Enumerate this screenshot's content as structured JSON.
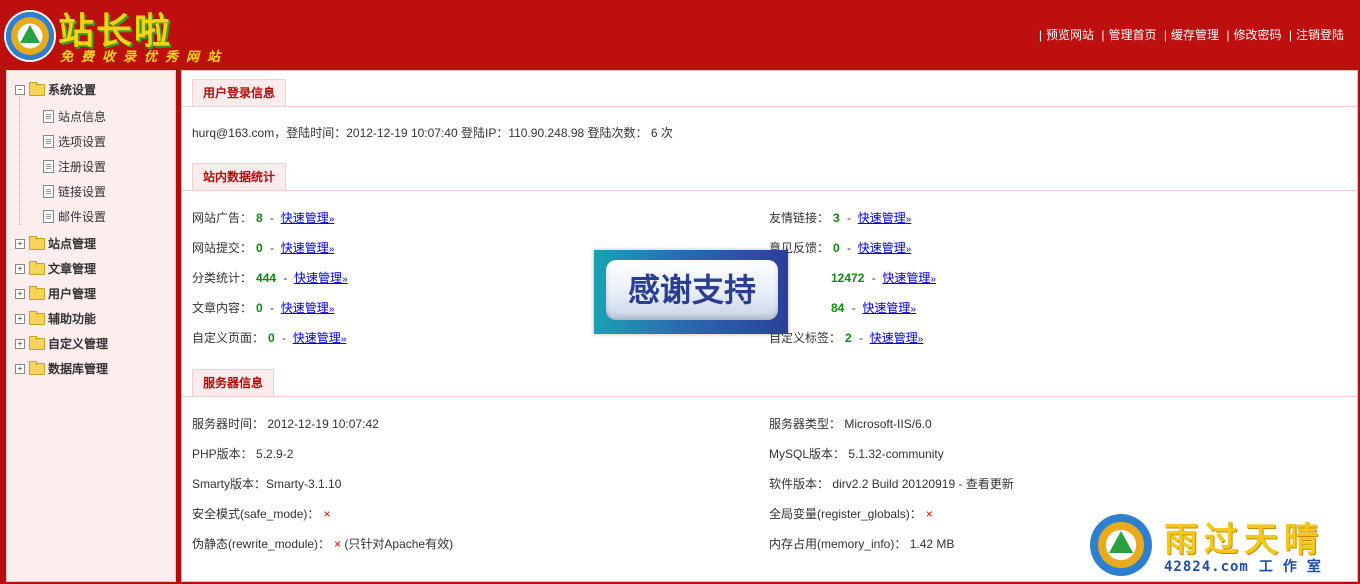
{
  "header": {
    "logo_title": "站长啦",
    "logo_subtitle": "免费收录优秀网站",
    "nav": [
      "预览网站",
      "管理首页",
      "缓存管理",
      "修改密码",
      "注销登陆"
    ]
  },
  "sidebar": {
    "groups": [
      {
        "label": "系统设置",
        "expanded": true,
        "children": [
          "站点信息",
          "选项设置",
          "注册设置",
          "链接设置",
          "邮件设置"
        ]
      },
      {
        "label": "站点管理",
        "expanded": false
      },
      {
        "label": "文章管理",
        "expanded": false
      },
      {
        "label": "用户管理",
        "expanded": false
      },
      {
        "label": "辅助功能",
        "expanded": false
      },
      {
        "label": "自定义管理",
        "expanded": false
      },
      {
        "label": "数据库管理",
        "expanded": false
      }
    ]
  },
  "login_info": {
    "title": "用户登录信息",
    "line": "hurq@163.com，登陆时间：2012-12-19 10:07:40    登陆IP：110.90.248.98    登陆次数： 6 次"
  },
  "stats": {
    "title": "站内数据统计",
    "quick_manage": "快速管理",
    "left": [
      {
        "label": "网站广告：",
        "value": "8"
      },
      {
        "label": "网站提交：",
        "value": "0"
      },
      {
        "label": "分类统计：",
        "value": "444"
      },
      {
        "label": "文章内容：",
        "value": "0"
      },
      {
        "label": "自定义页面：",
        "value": "0"
      }
    ],
    "right": [
      {
        "label": "友情链接：",
        "value": "3"
      },
      {
        "label": "意见反馈：",
        "value": "0"
      },
      {
        "label": "",
        "value": "12472"
      },
      {
        "label": "",
        "value": "84"
      },
      {
        "label": "自定义标签：",
        "value": "2"
      }
    ]
  },
  "server": {
    "title": "服务器信息",
    "left": [
      {
        "label": "服务器时间：",
        "value": "2012-12-19   10:07:42"
      },
      {
        "label": "PHP版本：",
        "value": "5.2.9-2"
      },
      {
        "label": "Smarty版本：",
        "value": "Smarty-3.1.10"
      },
      {
        "label": "安全模式(safe_mode)：",
        "value": "×"
      },
      {
        "label": "伪静态(rewrite_module)：",
        "value": "×",
        "note": "(只针对Apache有效)"
      }
    ],
    "right": [
      {
        "label": "服务器类型：",
        "value": "Microsoft-IIS/6.0"
      },
      {
        "label": "MySQL版本：",
        "value": "5.1.32-community"
      },
      {
        "label": "软件版本：",
        "value": "dirv2.2 Build 20120919 - 查看更新"
      },
      {
        "label": "全局变量(register_globals)：",
        "value": "×"
      },
      {
        "label": "内存占用(memory_info)：",
        "value": "1.42 MB"
      }
    ]
  },
  "overlay": {
    "text": "感谢支持"
  },
  "watermark": {
    "brand": "雨过天晴",
    "site": "42824.com",
    "studio": "工作室"
  },
  "colors": {
    "brand_red": "#be0f0f",
    "value_green": "#0b8a0b",
    "cross_red": "#e00000",
    "tab_text": "#b40d0d"
  }
}
